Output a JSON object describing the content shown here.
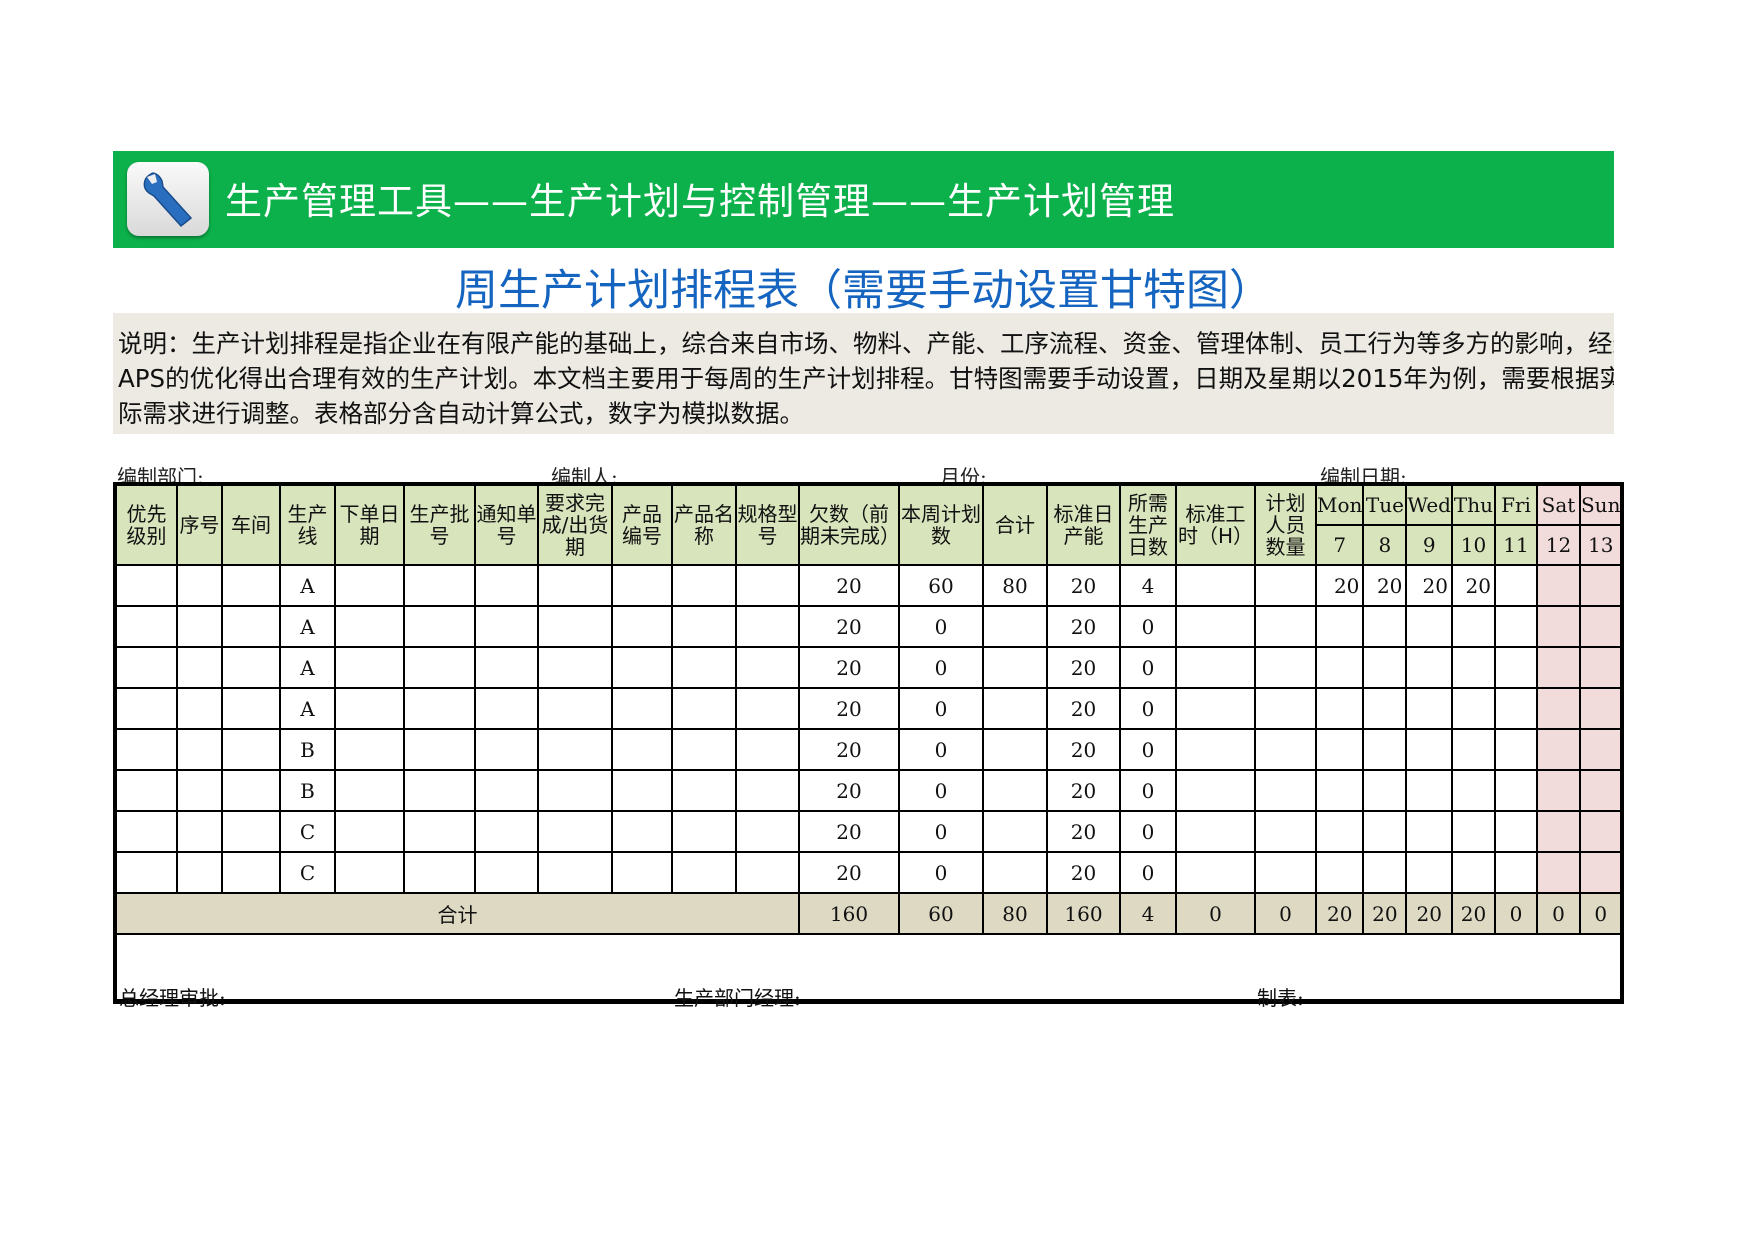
{
  "banner": {
    "icon": "wrench-icon",
    "title": "生产管理工具——生产计划与控制管理——生产计划管理"
  },
  "document": {
    "title": "周生产计划排程表（需要手动设置甘特图）",
    "description": "说明：生产计划排程是指企业在有限产能的基础上，综合来自市场、物料、产能、工序流程、资金、管理体制、员工行为等多方的影响，经过APS的优化得出合理有效的生产计划。本文档主要用于每周的生产计划排程。甘特图需要手动设置，日期及星期以2015年为例，需要根据实际需求进行调整。表格部分含自动计算公式，数字为模拟数据。"
  },
  "meta": {
    "department_label": "编制部门:",
    "author_label": "编制人:",
    "month_label": "月份:",
    "date_label": "编制日期:"
  },
  "table": {
    "headers": [
      "优先级别",
      "序号",
      "车间",
      "生产线",
      "下单日期",
      "生产批号",
      "通知单号",
      "要求完成/出货期",
      "产品编号",
      "产品名称",
      "规格型号",
      "欠数（前期未完成）",
      "本周计划数",
      "合计",
      "标准日产能",
      "所需生产日数",
      "标准工时（H）",
      "计划人员数量"
    ],
    "days": [
      {
        "weekday": "Mon",
        "date": "7",
        "weekend": false
      },
      {
        "weekday": "Tue",
        "date": "8",
        "weekend": false
      },
      {
        "weekday": "Wed",
        "date": "9",
        "weekend": false
      },
      {
        "weekday": "Thu",
        "date": "10",
        "weekend": false
      },
      {
        "weekday": "Fri",
        "date": "11",
        "weekend": false
      },
      {
        "weekday": "Sat",
        "date": "12",
        "weekend": true
      },
      {
        "weekday": "Sun",
        "date": "13",
        "weekend": true
      }
    ],
    "rows": [
      {
        "priority": "",
        "seq": "",
        "workshop": "",
        "line": "A",
        "order_date": "",
        "batch": "",
        "notice": "",
        "due": "",
        "product_no": "",
        "product_name": "",
        "spec": "",
        "backlog": "20",
        "week_plan": "60",
        "total": "80",
        "daily_capacity": "20",
        "days_needed": "4",
        "std_hours": "",
        "staff": "",
        "d0": "20",
        "d1": "20",
        "d2": "20",
        "d3": "20",
        "d4": "",
        "d5": "",
        "d6": ""
      },
      {
        "priority": "",
        "seq": "",
        "workshop": "",
        "line": "A",
        "order_date": "",
        "batch": "",
        "notice": "",
        "due": "",
        "product_no": "",
        "product_name": "",
        "spec": "",
        "backlog": "20",
        "week_plan": "0",
        "total": "",
        "daily_capacity": "20",
        "days_needed": "0",
        "std_hours": "",
        "staff": "",
        "d0": "",
        "d1": "",
        "d2": "",
        "d3": "",
        "d4": "",
        "d5": "",
        "d6": ""
      },
      {
        "priority": "",
        "seq": "",
        "workshop": "",
        "line": "A",
        "order_date": "",
        "batch": "",
        "notice": "",
        "due": "",
        "product_no": "",
        "product_name": "",
        "spec": "",
        "backlog": "20",
        "week_plan": "0",
        "total": "",
        "daily_capacity": "20",
        "days_needed": "0",
        "std_hours": "",
        "staff": "",
        "d0": "",
        "d1": "",
        "d2": "",
        "d3": "",
        "d4": "",
        "d5": "",
        "d6": ""
      },
      {
        "priority": "",
        "seq": "",
        "workshop": "",
        "line": "A",
        "order_date": "",
        "batch": "",
        "notice": "",
        "due": "",
        "product_no": "",
        "product_name": "",
        "spec": "",
        "backlog": "20",
        "week_plan": "0",
        "total": "",
        "daily_capacity": "20",
        "days_needed": "0",
        "std_hours": "",
        "staff": "",
        "d0": "",
        "d1": "",
        "d2": "",
        "d3": "",
        "d4": "",
        "d5": "",
        "d6": ""
      },
      {
        "priority": "",
        "seq": "",
        "workshop": "",
        "line": "B",
        "order_date": "",
        "batch": "",
        "notice": "",
        "due": "",
        "product_no": "",
        "product_name": "",
        "spec": "",
        "backlog": "20",
        "week_plan": "0",
        "total": "",
        "daily_capacity": "20",
        "days_needed": "0",
        "std_hours": "",
        "staff": "",
        "d0": "",
        "d1": "",
        "d2": "",
        "d3": "",
        "d4": "",
        "d5": "",
        "d6": ""
      },
      {
        "priority": "",
        "seq": "",
        "workshop": "",
        "line": "B",
        "order_date": "",
        "batch": "",
        "notice": "",
        "due": "",
        "product_no": "",
        "product_name": "",
        "spec": "",
        "backlog": "20",
        "week_plan": "0",
        "total": "",
        "daily_capacity": "20",
        "days_needed": "0",
        "std_hours": "",
        "staff": "",
        "d0": "",
        "d1": "",
        "d2": "",
        "d3": "",
        "d4": "",
        "d5": "",
        "d6": ""
      },
      {
        "priority": "",
        "seq": "",
        "workshop": "",
        "line": "C",
        "order_date": "",
        "batch": "",
        "notice": "",
        "due": "",
        "product_no": "",
        "product_name": "",
        "spec": "",
        "backlog": "20",
        "week_plan": "0",
        "total": "",
        "daily_capacity": "20",
        "days_needed": "0",
        "std_hours": "",
        "staff": "",
        "d0": "",
        "d1": "",
        "d2": "",
        "d3": "",
        "d4": "",
        "d5": "",
        "d6": ""
      },
      {
        "priority": "",
        "seq": "",
        "workshop": "",
        "line": "C",
        "order_date": "",
        "batch": "",
        "notice": "",
        "due": "",
        "product_no": "",
        "product_name": "",
        "spec": "",
        "backlog": "20",
        "week_plan": "0",
        "total": "",
        "daily_capacity": "20",
        "days_needed": "0",
        "std_hours": "",
        "staff": "",
        "d0": "",
        "d1": "",
        "d2": "",
        "d3": "",
        "d4": "",
        "d5": "",
        "d6": ""
      }
    ],
    "totals": {
      "label": "合计",
      "backlog": "160",
      "week_plan": "60",
      "total": "80",
      "daily_capacity": "160",
      "days_needed": "4",
      "std_hours": "0",
      "staff": "0",
      "d0": "20",
      "d1": "20",
      "d2": "20",
      "d3": "20",
      "d4": "0",
      "d5": "0",
      "d6": "0"
    }
  },
  "footer": {
    "gm_approval_label": "总经理审批:",
    "prod_manager_label": "生产部门经理:",
    "prepared_by_label": "制表:"
  },
  "colors": {
    "banner_green": "#0db14b",
    "title_blue": "#1565c0",
    "header_green": "#d8e4bc",
    "weekend_pink": "#f2dcdb",
    "total_tan": "#ddd9c3",
    "desc_bg": "#eceae2"
  }
}
